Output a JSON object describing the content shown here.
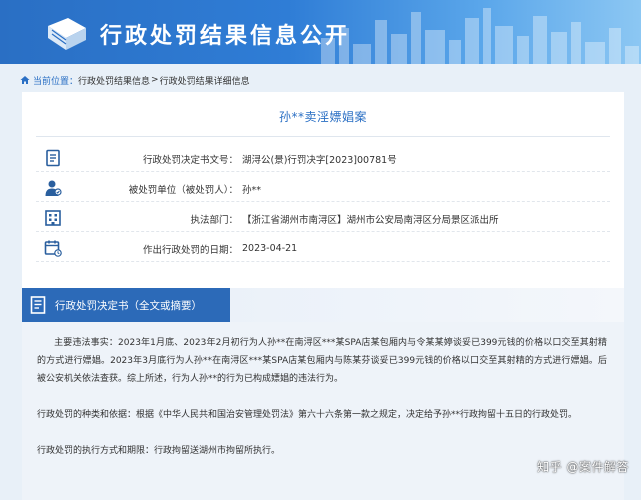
{
  "header": {
    "title": "行政处罚结果信息公开",
    "logo_icon": "book-icon",
    "brand_color": "#2a6fc4"
  },
  "breadcrumb": {
    "current_label": "当前位置：",
    "items": [
      "行政处罚结果信息",
      "行政处罚结果详细信息"
    ],
    "separator": ">"
  },
  "case": {
    "title": "孙**卖淫嫖娼案",
    "rows": [
      {
        "icon": "document-icon",
        "label": "行政处罚决定书文号：",
        "value": "湖浔公(景)行罚决字[2023]00781号"
      },
      {
        "icon": "person-icon",
        "label": "被处罚单位（被处罚人）：",
        "value": "孙**"
      },
      {
        "icon": "building-icon",
        "label": "执法部门：",
        "value": "【浙江省湖州市南浔区】湖州市公安局南浔区分局景区派出所"
      },
      {
        "icon": "calendar-icon",
        "label": "作出行政处罚的日期：",
        "value": "2023-04-21"
      }
    ]
  },
  "decision": {
    "section_title": "行政处罚决定书（全文或摘要）",
    "paragraphs": [
      "主要违法事实：2023年1月底、2023年2月初行为人孙**在南浔区***某SPA店某包厢内与令某某婷谈妥已399元钱的价格以口交至其射精的方式进行嫖娼。2023年3月底行为人孙**在南浔区***某SPA店某包厢内与陈某芬谈妥已399元钱的价格以口交至其射精的方式进行嫖娼。后被公安机关依法查获。综上所述，行为人孙**的行为已构成嫖娼的违法行为。",
      "行政处罚的种类和依据：根据《中华人民共和国治安管理处罚法》第六十六条第一款之规定，决定给予孙**行政拘留十五日的行政处罚。",
      "行政处罚的执行方式和期限：行政拘留送湖州市拘留所执行。"
    ]
  },
  "watermark": "知乎 @案件解答"
}
